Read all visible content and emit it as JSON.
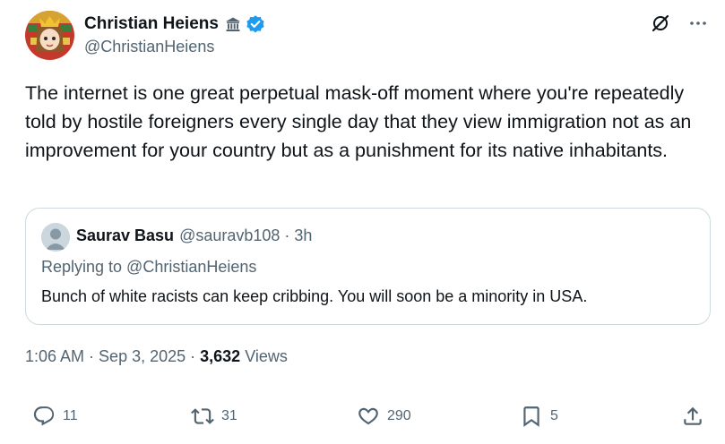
{
  "author": {
    "display_name": "Christian Heiens",
    "handle": "@ChristianHeiens"
  },
  "tweet": {
    "text": "The internet is one great perpetual mask-off moment where you're repeatedly told by hostile foreigners every single day that they view immigration not as an improvement for your country but as a punishment for its native inhabitants."
  },
  "quoted": {
    "display_name": "Saurav Basu",
    "handle": "@sauravb108",
    "separator": "·",
    "time": "3h",
    "replying_to": "Replying to @ChristianHeiens",
    "text": "Bunch of white racists can keep cribbing. You will soon be a minority in USA."
  },
  "meta": {
    "time": "1:06 AM",
    "separator": "·",
    "date": "Sep 3, 2025",
    "views_count": "3,632",
    "views_label": "Views"
  },
  "actions": {
    "replies": "11",
    "reposts": "31",
    "likes": "290",
    "bookmarks": "5"
  },
  "icons": {
    "institution": "institution-icon",
    "verified": "verified-badge-icon",
    "grok": "grok-icon",
    "more": "more-icon",
    "reply": "reply-icon",
    "retweet": "retweet-icon",
    "like": "heart-icon",
    "bookmark": "bookmark-icon",
    "share": "share-icon"
  },
  "colors": {
    "verified": "#1d9bf0",
    "secondary_text": "#536471",
    "primary_text": "#0f1419",
    "border": "#cfd9de"
  }
}
